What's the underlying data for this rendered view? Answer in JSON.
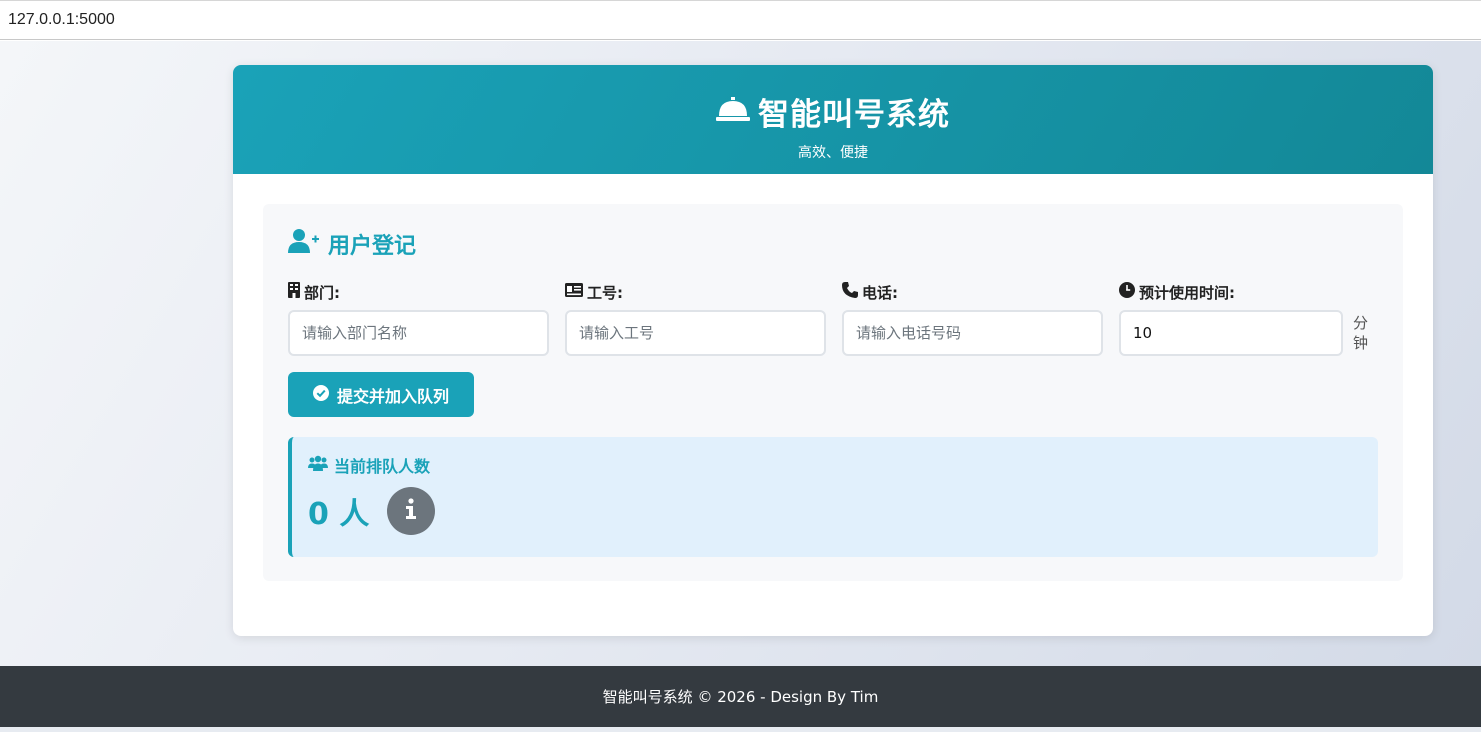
{
  "browser": {
    "url": "127.0.0.1:5000"
  },
  "header": {
    "title": "智能叫号系统",
    "subtitle": "高效、便捷",
    "icon": "bell-icon"
  },
  "register": {
    "title": "用户登记",
    "icon": "user-plus-icon",
    "fields": {
      "department": {
        "label": "部门:",
        "placeholder": "请输入部门名称",
        "value": "",
        "icon": "building-icon"
      },
      "employee_id": {
        "label": "工号:",
        "placeholder": "请输入工号",
        "value": "",
        "icon": "id-card-icon"
      },
      "phone": {
        "label": "电话:",
        "placeholder": "请输入电话号码",
        "value": "",
        "icon": "phone-icon"
      },
      "time": {
        "label": "预计使用时间:",
        "value": "10",
        "unit": "分钟",
        "icon": "clock-icon"
      }
    },
    "submit_label": "提交并加入队列"
  },
  "queue": {
    "title": "当前排队人数",
    "count_text": "0 人",
    "icon": "users-icon"
  },
  "footer": {
    "text": "智能叫号系统 © 2026 - Design By Tim"
  },
  "colors": {
    "accent": "#1aa2b8",
    "footer_bg": "#343a40",
    "queue_bg": "#e1f0fc"
  }
}
